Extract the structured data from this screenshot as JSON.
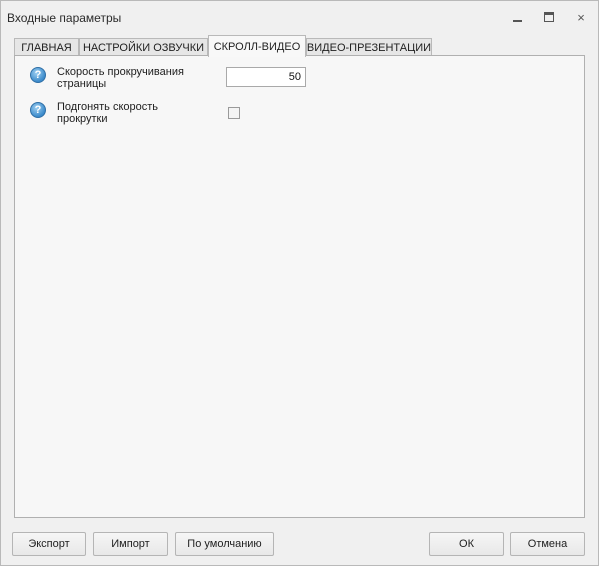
{
  "window": {
    "title": "Входные параметры",
    "minimize_icon": "minimize-icon",
    "maximize_icon": "maximize-icon",
    "close_icon": "close-icon",
    "close_glyph": "×"
  },
  "tabs": [
    {
      "label": "ГЛАВНАЯ",
      "active": false
    },
    {
      "label": "НАСТРОЙКИ ОЗВУЧКИ",
      "active": false
    },
    {
      "label": "СКРОЛЛ-ВИДЕО",
      "active": true
    },
    {
      "label": "ВИДЕО-ПРЕЗЕНТАЦИИ",
      "active": false
    }
  ],
  "settings": {
    "scroll_speed": {
      "label_line1": "Скорость прокручивания",
      "label_line2": "страницы",
      "value": "50",
      "help_icon": "help-icon",
      "help_glyph": "?"
    },
    "adjust_speed": {
      "label_line1": "Подгонять скорость",
      "label_line2": "прокрутки",
      "checked": false,
      "help_icon": "help-icon",
      "help_glyph": "?"
    }
  },
  "buttons": {
    "export": "Экспорт",
    "import": "Импорт",
    "default": "По умолчанию",
    "ok": "ОК",
    "cancel": "Отмена"
  },
  "colors": {
    "window_bg": "#f0f0f0",
    "panel_bg": "#f7f7f7",
    "border": "#b9b9b9",
    "help_icon": "#3c8bcb"
  }
}
